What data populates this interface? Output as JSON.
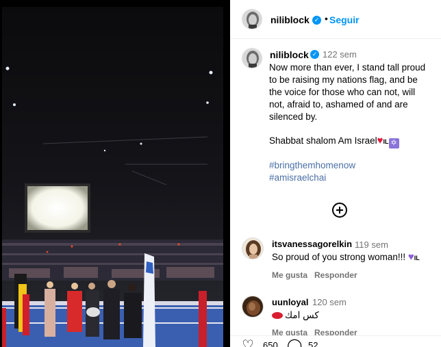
{
  "post": {
    "author": "niliblock",
    "follow_label": "Seguir",
    "caption_time": "122 sem",
    "caption_lines": [
      "Now more than ever, I stand tall proud",
      "to be raising my nations flag, and be",
      "the voice for those who can not, will",
      "not, afraid to, ashamed of and are",
      "silenced by."
    ],
    "shabbat": "Shabbat shalom Am Israel",
    "il_text": "IL",
    "star_glyph": "✡",
    "hashtags": [
      "#bringthemhomenow",
      "#amisraelchai"
    ]
  },
  "comments": [
    {
      "user": "itsvanessagorelkin",
      "time": "119 sem",
      "text": "So proud of you strong woman!!!",
      "emoji_il": "IL",
      "like_label": "Me gusta",
      "reply_label": "Responder"
    },
    {
      "user": "uunloyal",
      "time": "120 sem",
      "text": "كس امك",
      "like_label": "Me gusta",
      "reply_label": "Responder"
    }
  ],
  "actions": {
    "likes_count": "650",
    "comments_count": "52"
  },
  "icons": {
    "verified": "verified-badge-icon",
    "add": "plus-circle-icon",
    "heart": "heart-icon",
    "comment": "comment-icon"
  },
  "colors": {
    "link_blue": "#0095f6",
    "verified_blue": "#0095f6",
    "muted_text": "#737373",
    "hashtag": "#4a6fa5"
  }
}
